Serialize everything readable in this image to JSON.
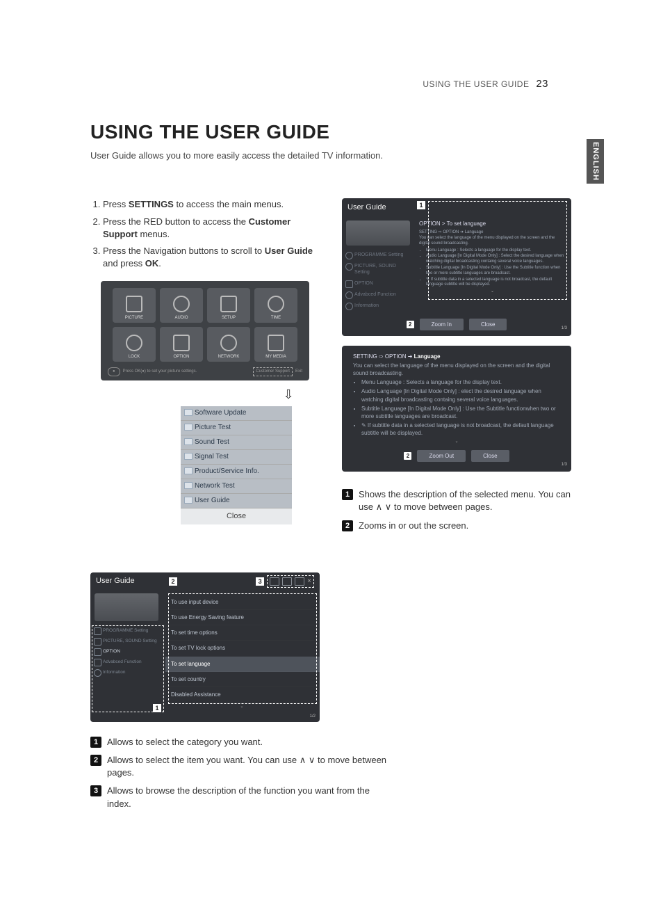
{
  "running_head": {
    "title": "USING THE USER GUIDE",
    "page": "23"
  },
  "side_tab": "ENGLISH",
  "heading": "USING THE USER GUIDE",
  "intro": "User Guide allows you to more easily access the detailed TV information.",
  "steps": [
    {
      "plain1": "Press ",
      "bold1": "SETTINGS",
      "plain2": " to access the main menus."
    },
    {
      "plain1": "Press the RED button to access the ",
      "bold1": "Customer Support",
      "plain2": " menus."
    },
    {
      "plain1": "Press the Navigation buttons to scroll to ",
      "bold1": "User Guide",
      "plain2": " and press ",
      "bold2": "OK",
      "plain3": "."
    }
  ],
  "menu_tiles": [
    "PICTURE",
    "AUDIO",
    "SETUP",
    "TIME",
    "LOCK",
    "OPTION",
    "NETWORK",
    "MY MEDIA"
  ],
  "hint": {
    "key": "●",
    "text": "Press OK(●) to set your picture settings.",
    "right1": "Customer Support",
    "right2": "Exit"
  },
  "dropdown": {
    "items": [
      "Software Update",
      "Picture Test",
      "Sound Test",
      "Signal Test",
      "Product/Service Info.",
      "Network Test",
      "User Guide"
    ],
    "close": "Close"
  },
  "guide_right": {
    "title": "User Guide",
    "callout1": "1",
    "breadcrumb": "OPTION > To set language",
    "side_items": [
      "PROGRAMME Setting",
      "PICTURE, SOUND Setting",
      "OPTION",
      "Advabced Function",
      "Information"
    ],
    "desc_bc": "SETTING ⇨ OPTION ➔ Language",
    "desc_main": "You can select the language of the menu displayed on the screen and the digital sound broadcasting.",
    "bullets": [
      "Menu Language : Selects a language for the display text.",
      "Audio Language  [In Digital Mode Only] : Select the desired language when watching digital broadcasting containg several voice languages.",
      "Subtitle Language [In Digital Mode Only] : Use the Subtitle function when two or more subtitle languages are broadcast.",
      "✎ If subtitle data in a selected language is not broadcast, the default language subtitle will be displayed."
    ],
    "footer_num": "2",
    "zoom_in": "Zoom In",
    "close": "Close",
    "pagecount": "1/3"
  },
  "zoomed": {
    "bc_prefix": "SETTING ⇨ OPTION ➔ ",
    "bc_last": "Language",
    "main": "You can select the language of the menu displayed on the screen and the digital sound broadcasting.",
    "bullets": [
      "Menu Language : Selects a language for the display text.",
      "Audio Language  [In Digital Mode Only] : elect the desired language when watching digital broadcasting containg several voice languages.",
      "Subtitle Language [In Digital Mode Only] : Use the Subtitle functionwhen two or more subtitle languages are broadcast.",
      "✎ If subtitle data in a selected language is not broadcast, the default language subtitle will be displayed."
    ],
    "footer_num": "2",
    "zoom_out": "Zoom Out",
    "close": "Close",
    "pagecount": "1/3"
  },
  "right_annotations": [
    "Shows the description of the selected menu. You can use ∧ ∨ to move between pages.",
    "Zooms in or out the screen."
  ],
  "cat_panel": {
    "title": "User Guide",
    "num2": "2",
    "num3": "3",
    "side": [
      "PROGRAMME Setting",
      "PICTURE, SOUND Setting",
      "OPTION",
      "Advabced Function",
      "Information"
    ],
    "items": [
      "To use input device",
      "To use Energy Saving feature",
      "To set time options",
      "To set TV lock options",
      "To set language",
      "To set country",
      "Disabled Assistance"
    ],
    "highlight_index": 4,
    "num1": "1",
    "pagecount": "1/2"
  },
  "left_annotations": [
    "Allows to select the category you want.",
    "Allows to select the item you want. You can use ∧ ∨ to move between pages.",
    "Allows to browse the description of the function you want from the index."
  ]
}
